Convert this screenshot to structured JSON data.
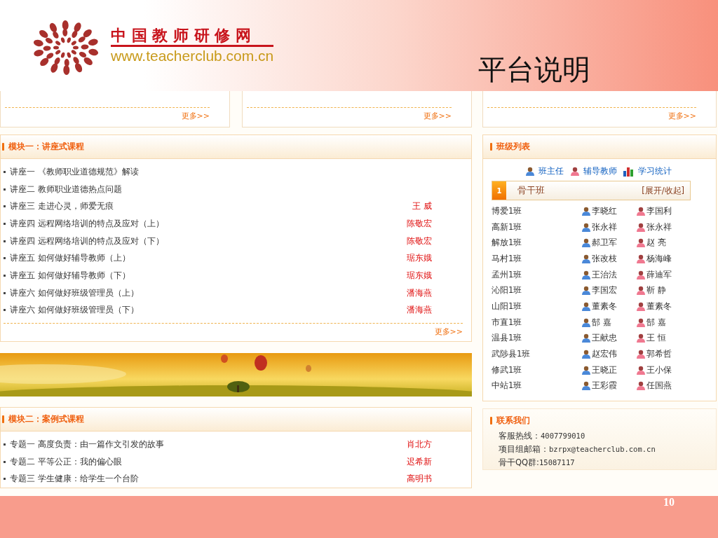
{
  "slide": {
    "site_name": "中 国 教 师 研 修 网",
    "site_url": "www.teacherclub.com.cn",
    "title": "平台说明",
    "page_number": "10"
  },
  "top_cards": [
    {
      "more": "更多>>"
    },
    {
      "more": "更多>>"
    },
    {
      "more": "更多>>"
    }
  ],
  "module_one": {
    "title": "模块一：讲座式课程",
    "more": "更多>>",
    "items": [
      {
        "title": "讲座一 《教师职业道德规范》解读"
      },
      {
        "title": "讲座二 教师职业道德热点问题"
      },
      {
        "title": "讲座三 走进心灵，师爱无痕",
        "speaker": "王 威"
      },
      {
        "title": "讲座四 远程网络培训的特点及应对（上）",
        "speaker": "陈敬宏"
      },
      {
        "title": "讲座四 远程网络培训的特点及应对（下）",
        "speaker": "陈敬宏"
      },
      {
        "title": "讲座五 如何做好辅导教师（上）",
        "speaker": "琚东娥"
      },
      {
        "title": "讲座五 如何做好辅导教师（下）",
        "speaker": "琚东娥"
      },
      {
        "title": "讲座六 如何做好班级管理员（上）",
        "speaker": "潘海燕"
      },
      {
        "title": "讲座六 如何做好班级管理员（下）",
        "speaker": "潘海燕"
      }
    ]
  },
  "module_two": {
    "title": "模块二：案例式课程",
    "items": [
      {
        "title": "专题一 高度负责：由一篇作文引发的故事",
        "speaker": "肖北方"
      },
      {
        "title": "专题二 平等公正：我的偏心眼",
        "speaker": "迟希新"
      },
      {
        "title": "专题三 学生健康：给学生一个台阶",
        "speaker": "高明书"
      }
    ]
  },
  "class_list": {
    "title": "班级列表",
    "legend": [
      "班主任",
      "辅导教师",
      "学习统计"
    ],
    "group": {
      "number": "1",
      "name": "骨干班",
      "toggle": "[展开/收起]"
    },
    "rows": [
      {
        "class": "博爱1班",
        "head_teacher": "李晓红",
        "tutor": "李国利"
      },
      {
        "class": "高新1班",
        "head_teacher": "张永祥",
        "tutor": "张永祥"
      },
      {
        "class": "解放1班",
        "head_teacher": "郝卫军",
        "tutor": "赵 亮"
      },
      {
        "class": "马村1班",
        "head_teacher": "张改枝",
        "tutor": "杨海峰"
      },
      {
        "class": "孟州1班",
        "head_teacher": "王治法",
        "tutor": "薛迪军"
      },
      {
        "class": "沁阳1班",
        "head_teacher": "李国宏",
        "tutor": "靳 静"
      },
      {
        "class": "山阳1班",
        "head_teacher": "董素冬",
        "tutor": "董素冬"
      },
      {
        "class": "市直1班",
        "head_teacher": "郜 嘉",
        "tutor": "郜 嘉"
      },
      {
        "class": "温县1班",
        "head_teacher": "王献忠",
        "tutor": "王 恒"
      },
      {
        "class": "武陟县1班",
        "head_teacher": "赵宏伟",
        "tutor": "郭希哲"
      },
      {
        "class": "修武1班",
        "head_teacher": "王晓正",
        "tutor": "王小保"
      },
      {
        "class": "中站1班",
        "head_teacher": "王彩霞",
        "tutor": "任国燕"
      }
    ]
  },
  "contact": {
    "title": "联系我们",
    "lines": [
      {
        "label": "客服热线：",
        "value": "4007799010"
      },
      {
        "label": "项目组邮箱：",
        "value": "bzrpx@teacherclub.com.cn"
      },
      {
        "label": "骨干QQ群:",
        "value": "15087117"
      }
    ]
  }
}
